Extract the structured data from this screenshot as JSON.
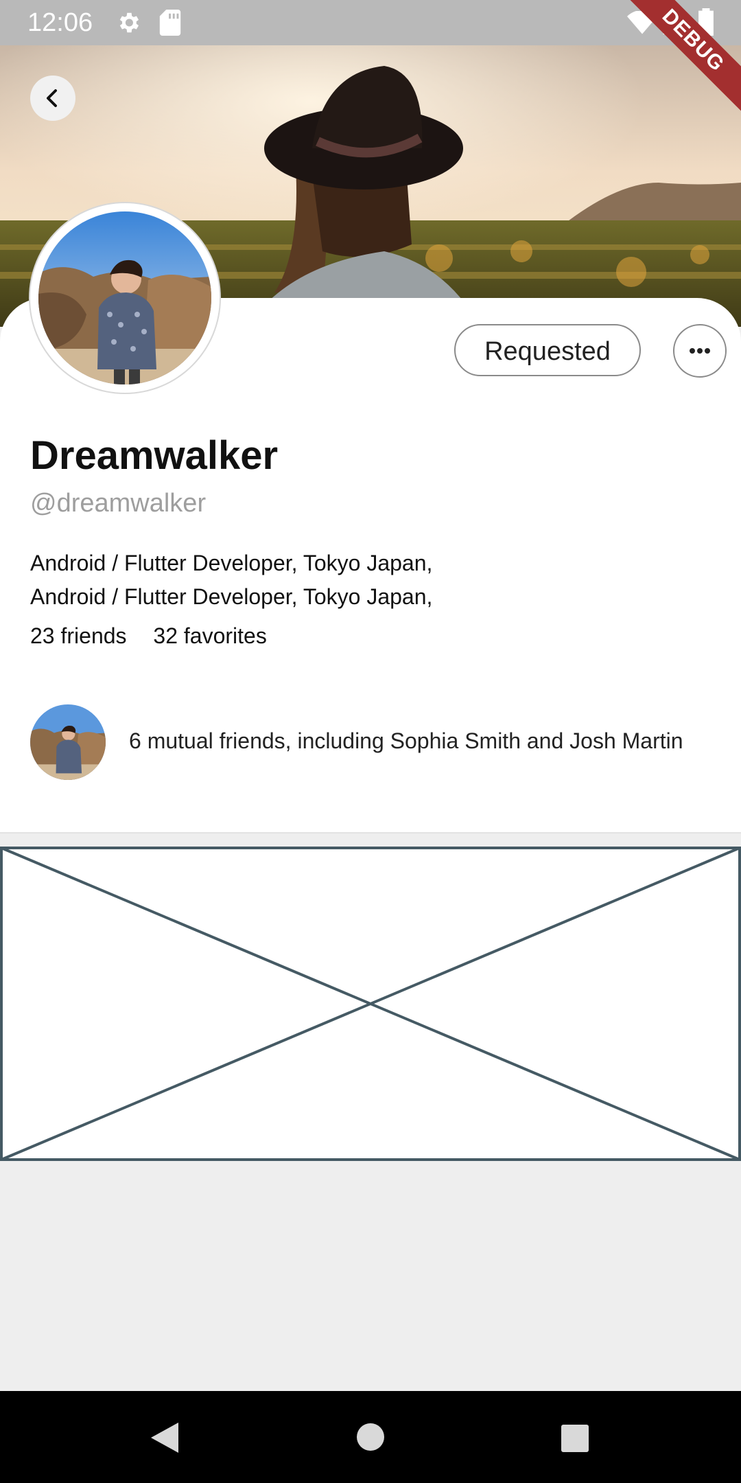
{
  "status_bar": {
    "time": "12:06",
    "icons": [
      "gear-icon",
      "sd-card-icon",
      "wifi-icon",
      "signal-icon",
      "battery-icon"
    ]
  },
  "debug_banner": "DEBUG",
  "header": {
    "back_icon": "chevron-left-icon"
  },
  "profile": {
    "name": "Dreamwalker",
    "handle": "@dreamwalker",
    "bio_lines": [
      "Android / Flutter Developer, Tokyo Japan,",
      "Android / Flutter Developer, Tokyo Japan,"
    ],
    "friends": "23 friends",
    "favorites": "32 favorites"
  },
  "actions": {
    "requested_label": "Requested",
    "more_icon": "more-horizontal-icon"
  },
  "mutual": {
    "text": "6 mutual friends, including Sophia Smith and Josh Martin"
  },
  "colors": {
    "placeholder_stroke": "#455a64",
    "debug_ribbon": "#a32f2f"
  }
}
